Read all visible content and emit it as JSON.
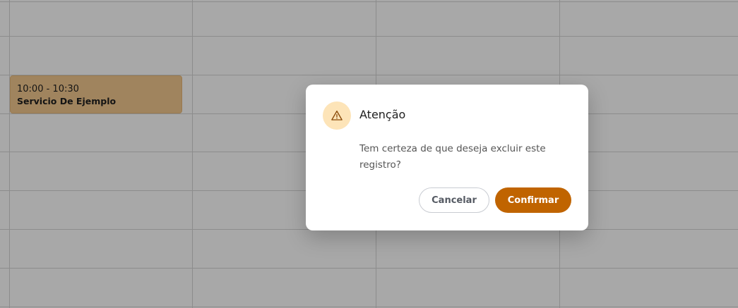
{
  "calendar": {
    "event": {
      "time": "10:00 - 10:30",
      "title": "Servicio De Ejemplo"
    }
  },
  "dialog": {
    "icon": "warning-triangle-icon",
    "title": "Atenção",
    "message": "Tem certeza de que deseja excluir este registro?",
    "cancel_label": "Cancelar",
    "confirm_label": "Confirmar"
  },
  "colors": {
    "accent": "#c06400",
    "icon_bg": "#fde4b8",
    "event_bg": "#f3c98f"
  }
}
